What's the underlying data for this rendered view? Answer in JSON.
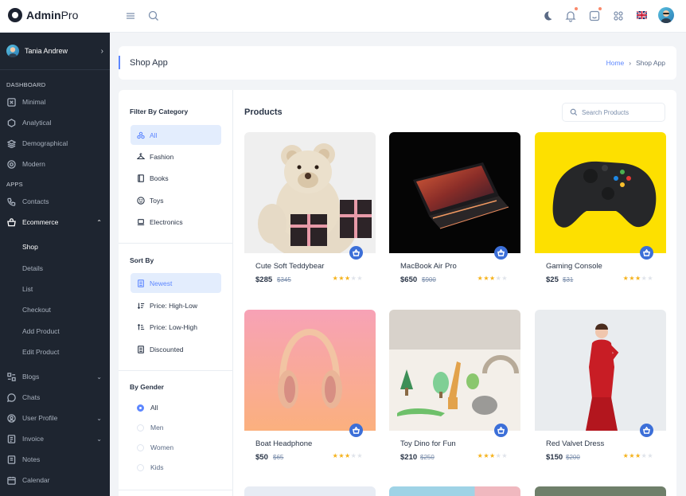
{
  "brand": {
    "name_bold": "Admin",
    "name_light": "Pro"
  },
  "user": {
    "name": "Tania Andrew"
  },
  "sidebar": {
    "dashboard_label": "DASHBOARD",
    "dashboard_items": [
      "Minimal",
      "Analytical",
      "Demographical",
      "Modern"
    ],
    "apps_label": "APPS",
    "contacts": "Contacts",
    "ecommerce": "Ecommerce",
    "ecommerce_sub": [
      "Shop",
      "Details",
      "List",
      "Checkout",
      "Add Product",
      "Edit Product"
    ],
    "more_items": [
      "Blogs",
      "Chats",
      "User Profile",
      "Invoice",
      "Notes",
      "Calendar"
    ]
  },
  "page": {
    "title": "Shop App",
    "crumb_home": "Home",
    "crumb_current": "Shop App"
  },
  "filters": {
    "category_heading": "Filter By Category",
    "categories": [
      "All",
      "Fashion",
      "Books",
      "Toys",
      "Electronics"
    ],
    "sort_heading": "Sort By",
    "sorts": [
      "Newest",
      "Price: High-Low",
      "Price: Low-High",
      "Discounted"
    ],
    "gender_heading": "By Gender",
    "genders": [
      "All",
      "Men",
      "Women",
      "Kids"
    ]
  },
  "products_section": {
    "title": "Products",
    "search_placeholder": "Search Products"
  },
  "products": [
    {
      "name": "Cute Soft Teddybear",
      "price": "$285",
      "old_price": "$345",
      "rating": 3
    },
    {
      "name": "MacBook Air Pro",
      "price": "$650",
      "old_price": "$900",
      "rating": 3
    },
    {
      "name": "Gaming Console",
      "price": "$25",
      "old_price": "$31",
      "rating": 3
    },
    {
      "name": "Boat Headphone",
      "price": "$50",
      "old_price": "$65",
      "rating": 3
    },
    {
      "name": "Toy Dino for Fun",
      "price": "$210",
      "old_price": "$250",
      "rating": 3
    },
    {
      "name": "Red Valvet Dress",
      "price": "$150",
      "old_price": "$200",
      "rating": 3
    }
  ],
  "colors": {
    "accent": "#5d87ff",
    "sidebar_bg": "#1e2530",
    "star": "#f5b21b"
  },
  "icons": {
    "menu": "hamburger-icon",
    "search": "search-icon",
    "theme": "moon-icon",
    "notifications": "bell-icon",
    "messages": "message-icon",
    "apps": "apps-icon",
    "language": "uk-flag-icon"
  }
}
